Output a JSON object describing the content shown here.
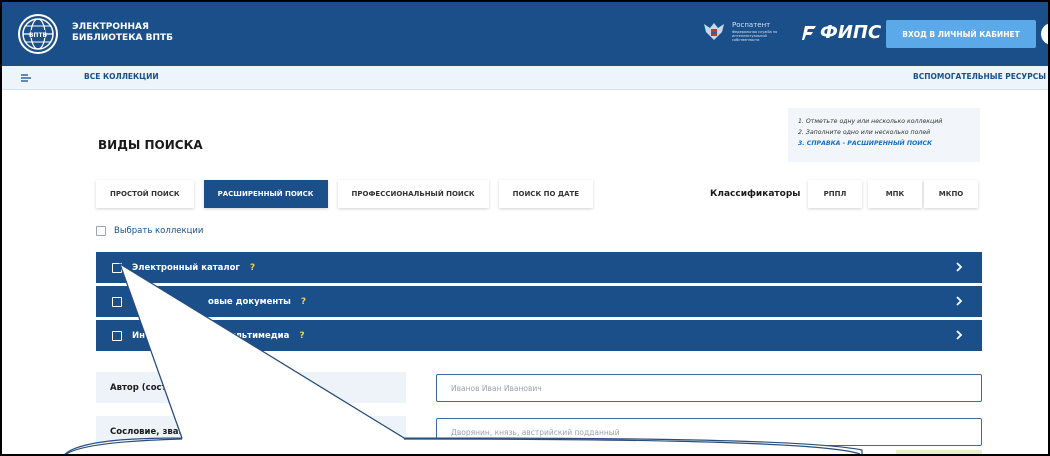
{
  "header": {
    "title_line1": "ЭЛЕКТРОННАЯ",
    "title_line2": "БИБЛИОТЕКА ВПТБ",
    "rospatent_label": "Роспатент",
    "rospatent_sub": "Федеральная служба по интеллектуальной собственности",
    "fips_label": "ФИПС",
    "login_button": "ВХОД В ЛИЧНЫЙ КАБИНЕТ",
    "help": "?"
  },
  "nav": {
    "all_collections": "ВСЕ КОЛЛЕКЦИИ",
    "aux_resources": "ВСПОМОГАТЕЛЬНЫЕ РЕСУРСЫ"
  },
  "main": {
    "search_types_title": "ВИДЫ ПОИСКА",
    "hints": {
      "line1": "1. Отметьте одну или несколько коллекций",
      "line2": "2. Заполните одно или несколько полей",
      "line3": "3. СПРАВКА - РАСШИРЕННЫЙ ПОИСК"
    },
    "tabs": [
      {
        "label": "ПРОСТОЙ ПОИСК",
        "active": false
      },
      {
        "label": "РАСШИРЕННЫЙ ПОИСК",
        "active": true
      },
      {
        "label": "ПРОФЕССИОНАЛЬНЫЙ ПОИСК",
        "active": false
      },
      {
        "label": "ПОИСК ПО ДАТЕ",
        "active": false
      }
    ],
    "classifiers_label": "Классификаторы",
    "classifiers": [
      "РППЛ",
      "МПК",
      "МКПО"
    ],
    "select_collections": "Выбрать коллекции",
    "collections": [
      {
        "label": "Электронный каталог",
        "help": "?"
      },
      {
        "label": "овые документы",
        "help": "?"
      },
      {
        "label": "Ин",
        "label_tail": "кты. Мультимедиа",
        "help": "?"
      }
    ],
    "fields": [
      {
        "label": "Автор (состав",
        "placeholder": "Иванов Иван Иванович"
      },
      {
        "label": "Сословие, звани",
        "placeholder": "Дворянин, князь, австрийский подданный"
      }
    ]
  },
  "colors": {
    "primary": "#1a4f8a",
    "accent_button": "#5ba9e8",
    "help_mark": "#f3d34a",
    "light_bg": "#eef4fb"
  }
}
